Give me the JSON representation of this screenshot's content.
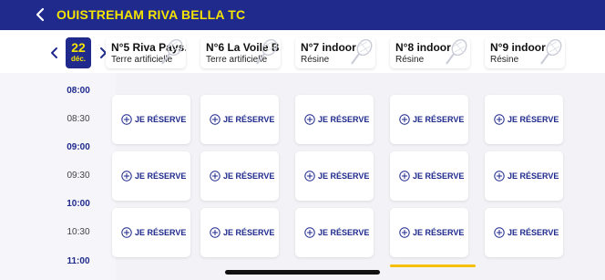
{
  "header": {
    "title": "OUISTREHAM RIVA BELLA TC",
    "back_icon": "chevron-left-icon"
  },
  "date": {
    "day": "22",
    "month": "déc."
  },
  "courts": [
    {
      "name": "N°5 Riva Pays…",
      "surface": "Terre artificielle"
    },
    {
      "name": "N°6 La Voile B…",
      "surface": "Terre artificielle"
    },
    {
      "name": "N°7 indoor",
      "surface": "Résine"
    },
    {
      "name": "N°8 indoor",
      "surface": "Résine"
    },
    {
      "name": "N°9 indoor",
      "surface": "Résine"
    }
  ],
  "times": [
    "08:00",
    "08:30",
    "09:00",
    "09:30",
    "10:00",
    "10:30",
    "11:00"
  ],
  "slot_label": "JE RÉSERVE",
  "colors": {
    "primary": "#1f2a8c",
    "accent": "#f5e400"
  }
}
